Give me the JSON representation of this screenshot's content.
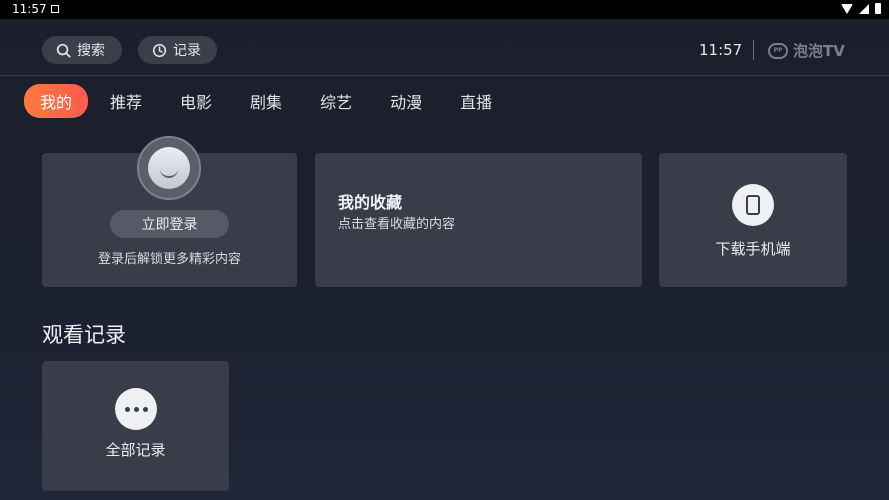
{
  "status_bar": {
    "time": "11:57"
  },
  "header": {
    "search_label": "搜索",
    "history_label": "记录",
    "clock": "11:57",
    "brand_name": "泡泡TV",
    "brand_logo_text": "PP"
  },
  "tabs": [
    {
      "label": "我的",
      "active": true
    },
    {
      "label": "推荐"
    },
    {
      "label": "电影"
    },
    {
      "label": "剧集"
    },
    {
      "label": "综艺"
    },
    {
      "label": "动漫"
    },
    {
      "label": "直播"
    }
  ],
  "login_card": {
    "button_label": "立即登录",
    "subtitle": "登录后解锁更多精彩内容"
  },
  "favorites_card": {
    "title": "我的收藏",
    "subtitle": "点击查看收藏的内容"
  },
  "download_card": {
    "label": "下载手机端"
  },
  "history_section": {
    "title": "观看记录",
    "all_label": "全部记录"
  },
  "colors": {
    "background": "#1c2130",
    "card": "#393d49",
    "active_tab_start": "#ff7a3d",
    "active_tab_end": "#ff5a4e"
  }
}
